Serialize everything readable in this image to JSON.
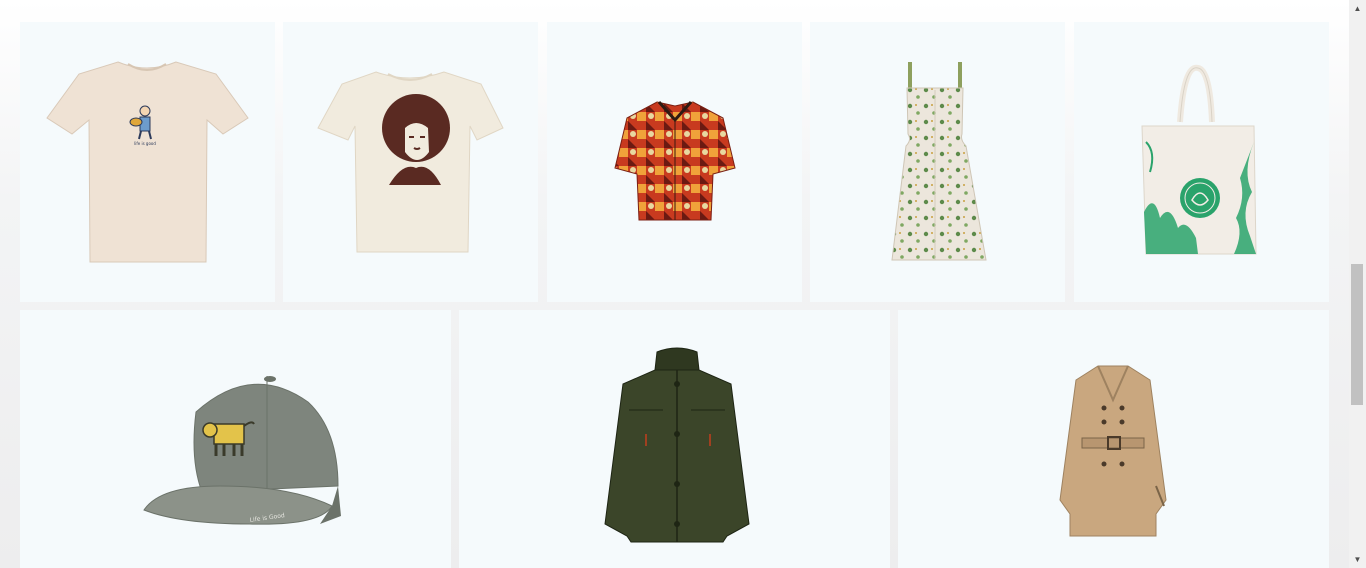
{
  "products": {
    "row1": [
      {
        "name": "cream graphic t-shirt",
        "icon": "t-shirt-icon"
      },
      {
        "name": "portrait print t-shirt",
        "icon": "t-shirt-icon"
      },
      {
        "name": "patterned short-sleeve shirt",
        "icon": "shirt-icon"
      },
      {
        "name": "floral sundress",
        "icon": "dress-icon"
      },
      {
        "name": "printed tote bag",
        "icon": "tote-bag-icon"
      }
    ],
    "row2": [
      {
        "name": "grey baseball cap",
        "icon": "cap-icon",
        "print_text": "Life is Good"
      },
      {
        "name": "olive field jacket",
        "icon": "jacket-icon"
      },
      {
        "name": "beige trench coat",
        "icon": "trench-coat-icon"
      }
    ]
  },
  "colors": {
    "tile_bg": "#f5fafc",
    "shirt1": "#efe2d4",
    "shirt2": "#f1ebde",
    "cap": "#7e857d",
    "jacket": "#3b4529",
    "coat": "#c9a77f",
    "tote_green": "#2aa36b"
  },
  "scrollbar": {
    "up_arrow": "▲",
    "down_arrow": "▼"
  }
}
